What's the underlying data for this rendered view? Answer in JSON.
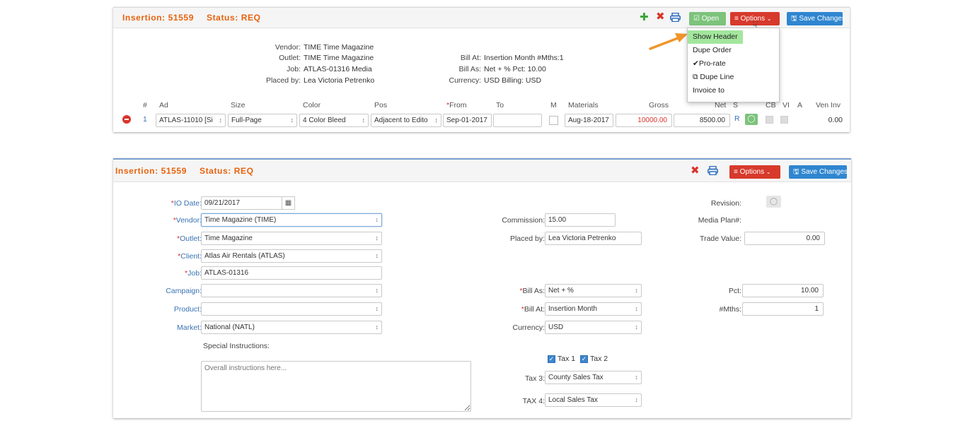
{
  "top": {
    "insertion": "Insertion: 51559",
    "status": "Status: REQ",
    "open_label": "Open",
    "options_label": "Options",
    "save_label": "Save Changes",
    "header": {
      "vendor_label": "Vendor:",
      "vendor": "TIME Time Magazine",
      "outlet_label": "Outlet:",
      "outlet": "TIME Time Magazine",
      "job_label": "Job:",
      "job": "ATLAS-01316  Media",
      "placed_label": "Placed by:",
      "placed": "Lea Victoria Petrenko",
      "bill_at_label": "Bill At:",
      "bill_at": "Insertion Month  #Mths:1",
      "bill_as_label": "Bill As:",
      "bill_as": "Net + %  Pct: 10.00",
      "currency_label": "Currency:",
      "currency": "USD  Billing: USD"
    },
    "menu": [
      "Show Header",
      "Dupe Order",
      "Pro-rate",
      "Dupe Line",
      "Invoice to"
    ],
    "columns": [
      "#",
      "Ad",
      "Size",
      "Color",
      "Pos",
      "From",
      "To",
      "M",
      "Materials",
      "Gross",
      "Net",
      "S",
      "CB",
      "VI",
      "A",
      "Ven Inv"
    ],
    "row": {
      "num": "1",
      "ad": "ATLAS-11010 [Si",
      "size": "Full-Page",
      "color": "4 Color Bleed",
      "pos": "Adjacent to Edito",
      "from": "Sep-01-2017",
      "to": "",
      "materials": "Aug-18-2017",
      "gross": "10000.00",
      "net": "8500.00",
      "s": "R",
      "ven_inv": "0.00"
    }
  },
  "bottom": {
    "insertion": "Insertion: 51559",
    "status": "Status: REQ",
    "options_label": "Options",
    "save_label": "Save Changes",
    "io_date_label": "IO Date:",
    "io_date": "09/21/2017",
    "vendor_label": "Vendor:",
    "vendor": "Time Magazine (TIME)",
    "outlet_label": "Outlet:",
    "outlet": "Time Magazine",
    "client_label": "Client:",
    "client": "Atlas Air Rentals (ATLAS)",
    "job_label": "Job:",
    "job": "ATLAS-01316",
    "campaign_label": "Campaign:",
    "campaign": "",
    "product_label": "Product:",
    "product": "",
    "market_label": "Market:",
    "market": "National (NATL)",
    "special_label": "Special Instructions:",
    "special_placeholder": "Overall instructions here...",
    "commission_label": "Commission:",
    "commission": "15.00",
    "placed_label": "Placed by:",
    "placed": "Lea Victoria Petrenko",
    "bill_as_label": "Bill As:",
    "bill_as": "Net + %",
    "bill_at_label": "Bill At:",
    "bill_at": "Insertion Month",
    "currency_label": "Currency:",
    "currency": "USD",
    "tax1_label": "Tax 1",
    "tax2_label": "Tax 2",
    "tax3_label": "Tax 3:",
    "tax3": "County Sales Tax",
    "tax4_label": "TAX 4:",
    "tax4": "Local Sales Tax",
    "revision_label": "Revision:",
    "media_plan_label": "Media Plan#:",
    "trade_label": "Trade Value:",
    "trade": "0.00",
    "pct_label": "Pct:",
    "pct": "10.00",
    "mths_label": "#Mths:",
    "mths": "1"
  }
}
